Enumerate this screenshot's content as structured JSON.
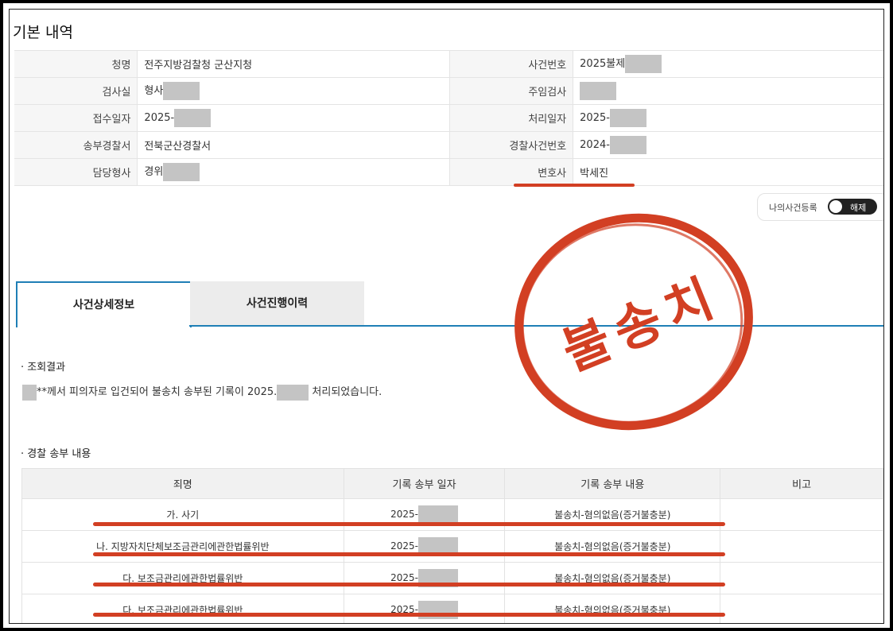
{
  "section_title": "기본 내역",
  "basic_rows": [
    {
      "l1": "청명",
      "v1": "전주지방검찰청 군산지청",
      "l2": "사건번호",
      "v2": "2025불제"
    },
    {
      "l1": "검사실",
      "v1": "형사",
      "l2": "주임검사",
      "v2": ""
    },
    {
      "l1": "접수일자",
      "v1": "2025-",
      "l2": "처리일자",
      "v2": "2025-"
    },
    {
      "l1": "송부경찰서",
      "v1": "전북군산경찰서",
      "l2": "경찰사건번호",
      "v2": "2024-"
    },
    {
      "l1": "담당형사",
      "v1": "경위",
      "l2": "변호사",
      "v2": "박세진"
    }
  ],
  "my_case_toggle": {
    "label": "나의사건등록",
    "state": "해제"
  },
  "tabs": [
    "사건상세정보",
    "사건진행이력"
  ],
  "result": {
    "title": "조회결과",
    "sentence_a": "**께서 피의자로 입건되어 불송치 송부된 기록이 2025.",
    "sentence_b": "처리되었습니다."
  },
  "police": {
    "title": "경찰 송부 내용",
    "headers": [
      "죄명",
      "기록 송부 일자",
      "기록 송부 내용",
      "비고"
    ],
    "rows": [
      {
        "crime": "가. 사기",
        "date": "2025-",
        "content": "불송치-혐의없음(증거불충분)",
        "note": ""
      },
      {
        "crime": "나. 지방자치단체보조금관리에관한법률위반",
        "date": "2025-",
        "content": "불송치-혐의없음(증거불충분)",
        "note": ""
      },
      {
        "crime": "다. 보조금관리에관한법률위반",
        "date": "2025-",
        "content": "불송치-혐의없음(증거불충분)",
        "note": ""
      },
      {
        "crime": "다. 보조금관리에관한법률위반",
        "date": "2025-",
        "content": "불송치-혐의없음(증거불충분)",
        "note": ""
      }
    ]
  },
  "stamp": {
    "text": "불송치",
    "color": "#d23f23"
  },
  "accent_color": "#1f7fb6"
}
